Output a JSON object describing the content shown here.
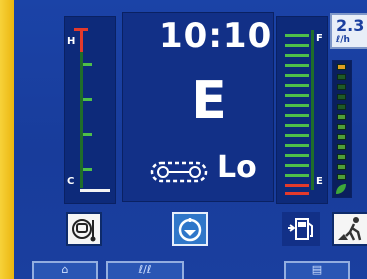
{
  "clock": {
    "time": "10:10"
  },
  "mode": {
    "letter": "E",
    "travel_speed": "Lo"
  },
  "water_temp_gauge": {
    "high_label": "H",
    "low_label": "C"
  },
  "fuel_gauge": {
    "full_label": "F",
    "empty_label": "E"
  },
  "fuel_consumption": {
    "value": "2.3",
    "unit": "ℓ/h"
  },
  "bottom_tabs": [
    {
      "label": "⌂"
    },
    {
      "label": "ℓ/ℓ"
    },
    {
      "label": "▤"
    }
  ],
  "icons": {
    "coolant": "coolant-temperature-icon",
    "hydraulic": "hydraulic-oil-icon",
    "fuel": "fuel-pump-icon",
    "worker": "work-mode-icon",
    "crawler": "crawler-track-icon"
  }
}
